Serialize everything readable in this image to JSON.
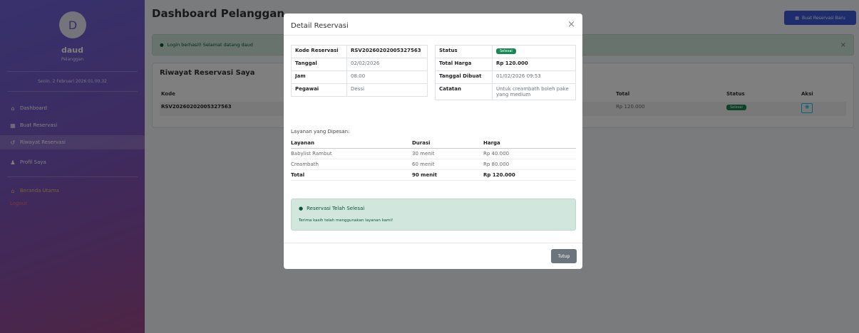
{
  "sidebar": {
    "avatar_initial": "D",
    "user_name": "daud",
    "user_role": "Pelanggan",
    "date": "Senin, 2 Februari 2026 01.00.32",
    "items": [
      {
        "label": "Dashboard",
        "icon": "home-icon"
      },
      {
        "label": "Buat Reservasi",
        "icon": "calendar-icon"
      },
      {
        "label": "Riwayat Reservasi",
        "icon": "history-icon"
      },
      {
        "label": "Profil Saya",
        "icon": "user-icon"
      },
      {
        "label": "Beranda Utama",
        "icon": "home-icon"
      },
      {
        "label": "Logout",
        "icon": "logout-icon"
      }
    ]
  },
  "header": {
    "title": "Dashboard Pelanggan",
    "new_button": "Buat Reservasi Baru"
  },
  "alert": {
    "text": "Login berhasil! Selamat datang daud"
  },
  "history": {
    "title": "Riwayat Reservasi Saya",
    "columns": [
      "Kode",
      "Total",
      "Status",
      "Aksi"
    ],
    "rows": [
      {
        "kode": "RSV20260202005327563",
        "total": "Rp 120.000",
        "status": "Selesai"
      }
    ]
  },
  "modal": {
    "title": "Detail Reservasi",
    "close_glyph": "×",
    "details_left": [
      {
        "key": "Kode Reservasi",
        "value": "RSV20260202005327563"
      },
      {
        "key": "Tanggal",
        "value": "02/02/2026"
      },
      {
        "key": "Jam",
        "value": "08:00"
      },
      {
        "key": "Pegawai",
        "value": "Dessi"
      }
    ],
    "details_right": [
      {
        "key": "Status",
        "value": "Selesai"
      },
      {
        "key": "Total Harga",
        "value": "Rp 120.000"
      },
      {
        "key": "Tanggal Dibuat",
        "value": "01/02/2026 09:53"
      },
      {
        "key": "Catatan",
        "value": "Untuk creambath boleh pake yang medium"
      }
    ],
    "services_label": "Layanan yang Dipesan:",
    "services_columns": [
      "Layanan",
      "Durasi",
      "Harga"
    ],
    "services": [
      {
        "name": "Babylist Rambut",
        "duration": "30 menit",
        "price": "Rp 40.000"
      },
      {
        "name": "Creambath",
        "duration": "60 menit",
        "price": "Rp 80.000"
      }
    ],
    "total": {
      "label": "Total",
      "duration": "90 menit",
      "price": "Rp 120.000"
    },
    "done_title": "Reservasi Telah Selesai",
    "done_text": "Terima kasih telah menggunakan layanan kami!",
    "close_button": "Tutup"
  }
}
